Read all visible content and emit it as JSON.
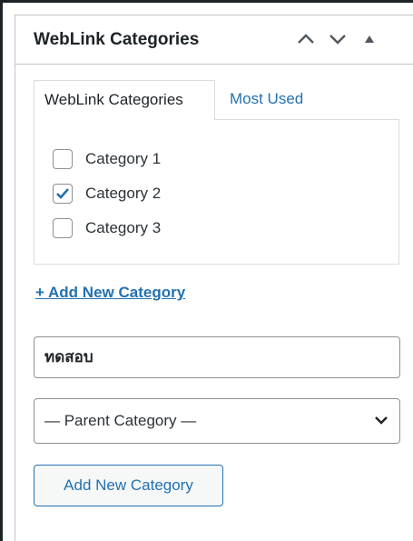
{
  "metabox": {
    "title": "WebLink Categories",
    "controls": [
      "move-up-icon",
      "move-down-icon",
      "toggle-panel-icon"
    ]
  },
  "tabs": [
    {
      "label": "WebLink Categories",
      "active": true
    },
    {
      "label": "Most Used",
      "active": false
    }
  ],
  "categories": [
    {
      "label": "Category 1",
      "checked": false
    },
    {
      "label": "Category 2",
      "checked": true
    },
    {
      "label": "Category 3",
      "checked": false
    }
  ],
  "add_link": "+ Add New Category",
  "new_category_input": {
    "value": "ทดสอบ"
  },
  "parent_select": {
    "selected": "— Parent Category —"
  },
  "submit_button": "Add New Category",
  "colors": {
    "accent": "#2271b1",
    "border": "#c3c4c7",
    "text": "#1d2327"
  }
}
